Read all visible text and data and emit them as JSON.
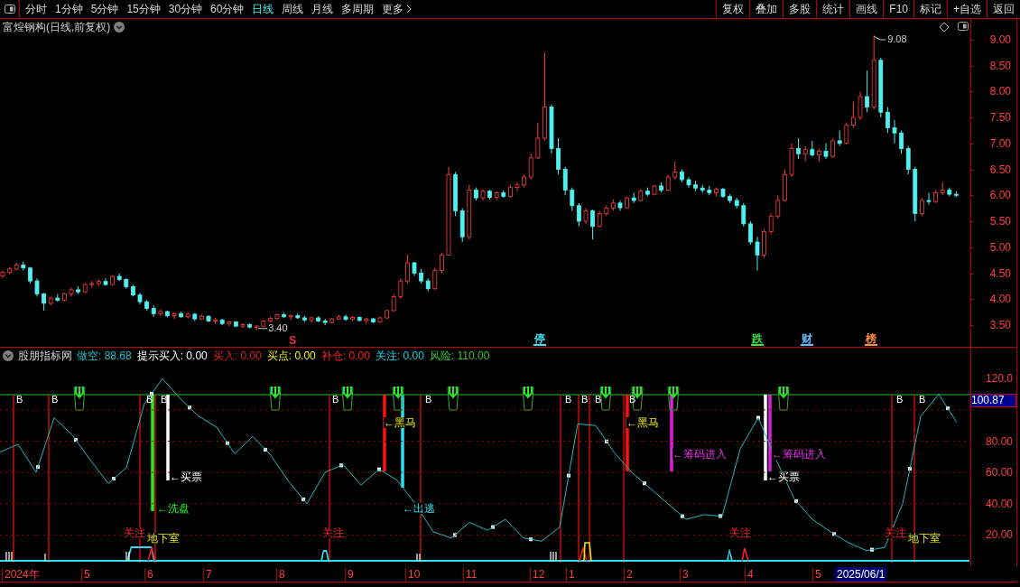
{
  "toolbar": {
    "periods": [
      {
        "label": "分时",
        "selected": false
      },
      {
        "label": "1分钟",
        "selected": false
      },
      {
        "label": "5分钟",
        "selected": false
      },
      {
        "label": "15分钟",
        "selected": false
      },
      {
        "label": "30分钟",
        "selected": false
      },
      {
        "label": "60分钟",
        "selected": false
      },
      {
        "label": "日线",
        "selected": true
      },
      {
        "label": "周线",
        "selected": false
      },
      {
        "label": "月线",
        "selected": false
      },
      {
        "label": "多周期",
        "selected": false
      },
      {
        "label": "更多",
        "selected": false
      }
    ],
    "actions": [
      "复权",
      "叠加",
      "多股",
      "统计",
      "画线",
      "F10",
      "标记",
      "+自选",
      "返回"
    ]
  },
  "chart_title": "富煌钢构(日线,前复权)",
  "price_chart": {
    "chart_data": {
      "type": "candlestick",
      "ylim": [
        3.5,
        9.4
      ],
      "yticks": [
        {
          "value": 9,
          "label": "9.00"
        },
        {
          "value": 8.5,
          "label": "8.50"
        },
        {
          "value": 8,
          "label": "8.00"
        },
        {
          "value": 7.5,
          "label": "7.50"
        },
        {
          "value": 7,
          "label": "7.00"
        },
        {
          "value": 6.5,
          "label": "6.50"
        },
        {
          "value": 6,
          "label": "6.00"
        },
        {
          "value": 5.5,
          "label": "5.50"
        },
        {
          "value": 5,
          "label": "5.00"
        },
        {
          "value": 4.5,
          "label": "4.50"
        },
        {
          "value": 4,
          "label": "4.00"
        },
        {
          "value": 3.5,
          "label": "3.50"
        }
      ],
      "ohlc": [
        [
          4.45,
          4.55,
          4.4,
          4.52
        ],
        [
          4.52,
          4.62,
          4.48,
          4.58
        ],
        [
          4.58,
          4.7,
          4.55,
          4.66
        ],
        [
          4.66,
          4.72,
          4.55,
          4.6
        ],
        [
          4.6,
          4.62,
          4.3,
          4.35
        ],
        [
          4.35,
          4.4,
          4.05,
          4.1
        ],
        [
          4.1,
          4.12,
          3.78,
          3.92
        ],
        [
          3.92,
          4.05,
          3.88,
          4.02
        ],
        [
          4.02,
          4.1,
          3.95,
          3.98
        ],
        [
          3.98,
          4.12,
          3.96,
          4.1
        ],
        [
          4.1,
          4.22,
          4.05,
          4.18
        ],
        [
          4.18,
          4.25,
          4.1,
          4.14
        ],
        [
          4.14,
          4.3,
          4.12,
          4.28
        ],
        [
          4.28,
          4.35,
          4.22,
          4.3
        ],
        [
          4.3,
          4.38,
          4.25,
          4.34
        ],
        [
          4.34,
          4.4,
          4.26,
          4.28
        ],
        [
          4.28,
          4.46,
          4.26,
          4.44
        ],
        [
          4.44,
          4.5,
          4.35,
          4.38
        ],
        [
          4.38,
          4.4,
          4.2,
          4.24
        ],
        [
          4.24,
          4.28,
          4.05,
          4.08
        ],
        [
          4.08,
          4.12,
          3.9,
          3.95
        ],
        [
          3.95,
          3.98,
          3.78,
          3.82
        ],
        [
          3.82,
          3.88,
          3.66,
          3.72
        ],
        [
          3.72,
          3.8,
          3.68,
          3.76
        ],
        [
          3.76,
          3.78,
          3.65,
          3.68
        ],
        [
          3.68,
          3.75,
          3.62,
          3.72
        ],
        [
          3.72,
          3.76,
          3.64,
          3.66
        ],
        [
          3.66,
          3.74,
          3.63,
          3.71
        ],
        [
          3.71,
          3.73,
          3.58,
          3.62
        ],
        [
          3.62,
          3.7,
          3.6,
          3.67
        ],
        [
          3.67,
          3.69,
          3.56,
          3.58
        ],
        [
          3.58,
          3.64,
          3.52,
          3.6
        ],
        [
          3.6,
          3.62,
          3.5,
          3.53
        ],
        [
          3.53,
          3.58,
          3.48,
          3.56
        ],
        [
          3.56,
          3.58,
          3.46,
          3.48
        ],
        [
          3.48,
          3.54,
          3.44,
          3.51
        ],
        [
          3.51,
          3.53,
          3.44,
          3.46
        ],
        [
          3.46,
          3.5,
          3.4,
          3.48
        ],
        [
          3.48,
          3.6,
          3.47,
          3.58
        ],
        [
          3.58,
          3.66,
          3.55,
          3.63
        ],
        [
          3.63,
          3.72,
          3.6,
          3.7
        ],
        [
          3.7,
          3.74,
          3.64,
          3.66
        ],
        [
          3.66,
          3.7,
          3.6,
          3.68
        ],
        [
          3.68,
          3.72,
          3.62,
          3.64
        ],
        [
          3.64,
          3.68,
          3.56,
          3.6
        ],
        [
          3.6,
          3.66,
          3.55,
          3.64
        ],
        [
          3.64,
          3.67,
          3.56,
          3.58
        ],
        [
          3.58,
          3.62,
          3.5,
          3.55
        ],
        [
          3.55,
          3.64,
          3.53,
          3.62
        ],
        [
          3.62,
          3.7,
          3.6,
          3.66
        ],
        [
          3.66,
          3.7,
          3.58,
          3.61
        ],
        [
          3.61,
          3.68,
          3.58,
          3.65
        ],
        [
          3.65,
          3.67,
          3.57,
          3.59
        ],
        [
          3.59,
          3.64,
          3.52,
          3.62
        ],
        [
          3.62,
          3.64,
          3.54,
          3.56
        ],
        [
          3.56,
          3.66,
          3.54,
          3.64
        ],
        [
          3.64,
          3.8,
          3.62,
          3.78
        ],
        [
          3.78,
          4.1,
          3.76,
          4.05
        ],
        [
          4.05,
          4.4,
          4.0,
          4.35
        ],
        [
          4.35,
          4.85,
          4.3,
          4.7
        ],
        [
          4.7,
          4.72,
          4.45,
          4.5
        ],
        [
          4.5,
          4.58,
          4.3,
          4.35
        ],
        [
          4.35,
          4.4,
          4.15,
          4.2
        ],
        [
          4.2,
          4.6,
          4.18,
          4.55
        ],
        [
          4.55,
          4.9,
          4.5,
          4.85
        ],
        [
          4.85,
          6.55,
          4.85,
          6.4
        ],
        [
          6.4,
          6.45,
          5.6,
          5.7
        ],
        [
          5.7,
          5.75,
          5.1,
          5.2
        ],
        [
          5.2,
          6.2,
          5.15,
          6.1
        ],
        [
          6.1,
          6.15,
          5.9,
          5.95
        ],
        [
          5.95,
          6.12,
          5.9,
          6.08
        ],
        [
          6.08,
          6.1,
          5.92,
          5.96
        ],
        [
          5.96,
          6.08,
          5.9,
          6.05
        ],
        [
          6.05,
          6.1,
          5.95,
          5.98
        ],
        [
          5.98,
          6.2,
          5.96,
          6.15
        ],
        [
          6.15,
          6.25,
          6.08,
          6.2
        ],
        [
          6.2,
          6.4,
          6.15,
          6.35
        ],
        [
          6.35,
          6.8,
          6.3,
          6.72
        ],
        [
          6.72,
          7.4,
          6.7,
          7.1
        ],
        [
          7.1,
          8.75,
          7.05,
          7.7
        ],
        [
          7.7,
          7.75,
          6.8,
          6.9
        ],
        [
          6.9,
          7.1,
          6.4,
          6.5
        ],
        [
          6.5,
          6.55,
          6.0,
          6.1
        ],
        [
          6.1,
          6.15,
          5.7,
          5.8
        ],
        [
          5.8,
          5.85,
          5.4,
          5.5
        ],
        [
          5.5,
          5.75,
          5.45,
          5.7
        ],
        [
          5.7,
          5.72,
          5.15,
          5.4
        ],
        [
          5.4,
          5.7,
          5.38,
          5.65
        ],
        [
          5.65,
          5.8,
          5.6,
          5.75
        ],
        [
          5.75,
          5.92,
          5.7,
          5.85
        ],
        [
          5.85,
          5.9,
          5.7,
          5.76
        ],
        [
          5.76,
          5.98,
          5.74,
          5.95
        ],
        [
          5.95,
          6.05,
          5.85,
          5.9
        ],
        [
          5.9,
          6.12,
          5.88,
          6.08
        ],
        [
          6.08,
          6.15,
          5.98,
          6.02
        ],
        [
          6.02,
          6.2,
          6.0,
          6.18
        ],
        [
          6.18,
          6.25,
          6.05,
          6.1
        ],
        [
          6.1,
          6.4,
          6.08,
          6.35
        ],
        [
          6.35,
          6.65,
          6.3,
          6.45
        ],
        [
          6.45,
          6.5,
          6.25,
          6.3
        ],
        [
          6.3,
          6.35,
          6.15,
          6.2
        ],
        [
          6.2,
          6.28,
          6.08,
          6.14
        ],
        [
          6.14,
          6.2,
          6.05,
          6.1
        ],
        [
          6.1,
          6.18,
          6.0,
          6.05
        ],
        [
          6.05,
          6.15,
          5.98,
          6.12
        ],
        [
          6.12,
          6.14,
          5.95,
          5.98
        ],
        [
          5.98,
          6.02,
          5.85,
          5.9
        ],
        [
          5.9,
          5.95,
          5.75,
          5.8
        ],
        [
          5.8,
          5.85,
          5.4,
          5.45
        ],
        [
          5.45,
          5.5,
          5.05,
          5.1
        ],
        [
          5.1,
          5.2,
          4.55,
          4.85
        ],
        [
          4.85,
          5.35,
          4.8,
          5.3
        ],
        [
          5.3,
          5.65,
          5.25,
          5.6
        ],
        [
          5.6,
          6.0,
          5.55,
          5.9
        ],
        [
          5.9,
          6.5,
          5.88,
          6.4
        ],
        [
          6.4,
          7.0,
          6.35,
          6.9
        ],
        [
          6.9,
          7.1,
          6.7,
          6.8
        ],
        [
          6.8,
          6.95,
          6.65,
          6.88
        ],
        [
          6.88,
          7.05,
          6.75,
          6.78
        ],
        [
          6.78,
          6.9,
          6.65,
          6.85
        ],
        [
          6.85,
          7.0,
          6.7,
          6.75
        ],
        [
          6.75,
          7.1,
          6.72,
          7.05
        ],
        [
          7.05,
          7.25,
          6.95,
          7.0
        ],
        [
          7.0,
          7.4,
          6.98,
          7.35
        ],
        [
          7.35,
          7.8,
          7.3,
          7.5
        ],
        [
          7.5,
          8.0,
          7.45,
          7.9
        ],
        [
          7.9,
          8.4,
          7.6,
          7.7
        ],
        [
          7.7,
          9.08,
          7.65,
          8.6
        ],
        [
          8.6,
          8.65,
          7.5,
          7.6
        ],
        [
          7.6,
          7.7,
          7.2,
          7.3
        ],
        [
          7.3,
          7.45,
          7.0,
          7.2
        ],
        [
          7.2,
          7.25,
          6.8,
          6.9
        ],
        [
          6.9,
          6.95,
          6.4,
          6.5
        ],
        [
          6.5,
          6.55,
          5.5,
          5.65
        ],
        [
          5.65,
          5.95,
          5.6,
          5.9
        ],
        [
          5.9,
          6.05,
          5.82,
          5.88
        ],
        [
          5.88,
          6.1,
          5.85,
          6.05
        ],
        [
          6.05,
          6.25,
          6.0,
          6.1
        ],
        [
          6.1,
          6.15,
          5.98,
          6.02
        ],
        [
          6.02,
          6.08,
          5.96,
          6.0
        ]
      ]
    },
    "high_label": "9.08",
    "low_label": "3.40",
    "sell_mark": "S"
  },
  "event_tags": [
    {
      "text": "停",
      "color": "#40e0f0"
    },
    {
      "text": "跌",
      "color": "#40e040"
    },
    {
      "text": "财",
      "color": "#60c0ff"
    },
    {
      "text": "榜",
      "color": "#ff9040"
    }
  ],
  "indicator": {
    "name": "股朋指标网",
    "readouts": [
      {
        "label": "做空:",
        "value": "88.68",
        "color": "#20c0c0"
      },
      {
        "label": "提示买入:",
        "value": "0.00",
        "color": "#ffffff"
      },
      {
        "label": "买入:",
        "value": "0.00",
        "color": "#e02020"
      },
      {
        "label": "买点:",
        "value": "0.00",
        "color": "#f0f000"
      },
      {
        "label": "补仓:",
        "value": "0.00",
        "color": "#ff2020"
      },
      {
        "label": "关注:",
        "value": "0.00",
        "color": "#20d0e0"
      },
      {
        "label": "风险:",
        "value": "110.00",
        "color": "#40c040"
      }
    ],
    "chart_data": {
      "type": "line",
      "ylim": [
        0,
        120
      ],
      "grid": true,
      "yticks": [
        {
          "value": 120,
          "label": "120.0"
        },
        {
          "value": 80,
          "label": "80.00"
        },
        {
          "value": 60,
          "label": "60.00"
        },
        {
          "value": 40,
          "label": "40.00"
        },
        {
          "value": 20,
          "label": "20.00"
        }
      ],
      "values": [
        73,
        78,
        60,
        95,
        84,
        68,
        53,
        63,
        104,
        120,
        107,
        96,
        89,
        72,
        83,
        71,
        54,
        40,
        60,
        65,
        52,
        62,
        55,
        40,
        22,
        18,
        28,
        23,
        30,
        18,
        16,
        25,
        91,
        90,
        73,
        60,
        50,
        40,
        30,
        33,
        32,
        75,
        95,
        68,
        43,
        30,
        22,
        15,
        10,
        12,
        40,
        96,
        110,
        92
      ]
    },
    "current_value": "100.87",
    "buy_marks": [
      "B",
      "B",
      "B",
      "B",
      "B",
      "B",
      "B",
      "B",
      "B",
      "B",
      "B",
      "B"
    ],
    "signals": [
      {
        "kind": "wash",
        "text": "←洗盘"
      },
      {
        "kind": "buy",
        "text": "←买票"
      },
      {
        "kind": "dark_horse",
        "text": "←黑马"
      },
      {
        "kind": "escape",
        "text": "←出逃"
      },
      {
        "kind": "dark_horse",
        "text": "←黑马"
      },
      {
        "kind": "chips",
        "text": "←筹码进入"
      },
      {
        "kind": "buy",
        "text": "←买票"
      },
      {
        "kind": "chips",
        "text": "←筹码进入"
      }
    ],
    "bottom_labels": [
      {
        "kind": "watch",
        "text": "关注"
      },
      {
        "kind": "basement",
        "text": "地下室"
      },
      {
        "kind": "watch",
        "text": "关注"
      },
      {
        "kind": "watch",
        "text": "关注"
      },
      {
        "kind": "watch",
        "text": "关注"
      },
      {
        "kind": "basement",
        "text": "地下室"
      }
    ]
  },
  "date_axis": [
    "2024年",
    "5",
    "6",
    "7",
    "8",
    "9",
    "10",
    "11",
    "12",
    "1",
    "2",
    "3",
    "4",
    "5"
  ],
  "current_date": "2025/06/1"
}
